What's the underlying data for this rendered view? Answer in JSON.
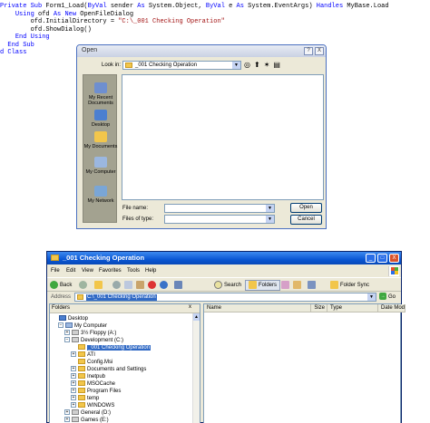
{
  "code": {
    "lines": [
      [
        {
          "t": "Private Sub",
          "k": "kw"
        },
        {
          "t": " Form1_Load("
        },
        {
          "t": "ByVal",
          "k": "kw"
        },
        {
          "t": " sender "
        },
        {
          "t": "As",
          "k": "kw"
        },
        {
          "t": " System.Object, "
        },
        {
          "t": "ByVal",
          "k": "kw"
        },
        {
          "t": " e "
        },
        {
          "t": "As",
          "k": "kw"
        },
        {
          "t": " System.EventArgs) "
        },
        {
          "t": "Handles",
          "k": "kw"
        },
        {
          "t": " MyBase.Load"
        }
      ],
      [
        {
          "t": "    "
        },
        {
          "t": "Using",
          "k": "kw"
        },
        {
          "t": " ofd "
        },
        {
          "t": "As New",
          "k": "kw"
        },
        {
          "t": " OpenFileDialog"
        }
      ],
      [
        {
          "t": "        ofd.InitialDirectory = "
        },
        {
          "t": "\"C:\\_001 Checking Operation\"",
          "k": "str"
        }
      ],
      [
        {
          "t": "        ofd.ShowDialog()"
        }
      ],
      [
        {
          "t": "    "
        },
        {
          "t": "End Using",
          "k": "kw"
        }
      ],
      [
        {
          "t": "  "
        },
        {
          "t": "End Sub",
          "k": "kw"
        }
      ],
      [
        {
          "t": "d Class",
          "k": "kw"
        }
      ]
    ]
  },
  "open_dialog": {
    "title": "Open",
    "help_glyph": "?",
    "close_glyph": "X",
    "look_in_label": "Look in:",
    "look_in_value": "_001 Checking Operation",
    "dropdown_glyph": "▼",
    "nav_icons": [
      "back-icon",
      "up-folder-icon",
      "new-folder-icon",
      "views-icon"
    ],
    "nav_glyphs": [
      "◎",
      "⬆",
      "✶",
      "▤"
    ],
    "places": [
      {
        "name": "recent",
        "label_1": "My Recent",
        "label_2": "Documents",
        "color": "#6e8fd0"
      },
      {
        "name": "desktop",
        "label_1": "Desktop",
        "label_2": "",
        "color": "#4b7fd0"
      },
      {
        "name": "documents",
        "label_1": "My Documents",
        "label_2": "",
        "color": "#f2c64b"
      },
      {
        "name": "computer",
        "label_1": "My Computer",
        "label_2": "",
        "color": "#9bb7e0"
      },
      {
        "name": "network",
        "label_1": "My Network",
        "label_2": "",
        "color": "#7aa6d6"
      }
    ],
    "file_name_label": "File name:",
    "file_name_value": "",
    "files_of_type_label": "Files of type:",
    "files_of_type_value": "",
    "open_button": "Open",
    "cancel_button": "Cancel"
  },
  "explorer": {
    "title": "_001 Checking Operation",
    "min_glyph": "_",
    "max_glyph": "□",
    "close_glyph": "X",
    "menus": [
      "File",
      "Edit",
      "View",
      "Favorites",
      "Tools",
      "Help"
    ],
    "toolbar": {
      "back": "Back",
      "search": "Search",
      "folders": "Folders",
      "folder_sync": "Folder Sync"
    },
    "address_label": "Address",
    "address_value": "C:\\_001 Checking Operation",
    "go_label": "Go",
    "go_glyph": "→",
    "folders_pane_title": "Folders",
    "folders_pane_close": "x",
    "scroll_up_glyph": "▲",
    "tree": [
      {
        "label": "Desktop",
        "indent": 0,
        "icon": "desk",
        "box": ""
      },
      {
        "label": "My Computer",
        "indent": 1,
        "icon": "comp",
        "box": "−"
      },
      {
        "label": "3½ Floppy (A:)",
        "indent": 2,
        "icon": "drive",
        "box": "+"
      },
      {
        "label": "Development (C:)",
        "indent": 2,
        "icon": "drive",
        "box": "−"
      },
      {
        "label": "_001 Checking Operation",
        "indent": 3,
        "icon": "folder",
        "box": "",
        "selected": true
      },
      {
        "label": "ATI",
        "indent": 3,
        "icon": "folder",
        "box": "+"
      },
      {
        "label": "Config.Msi",
        "indent": 3,
        "icon": "folder",
        "box": ""
      },
      {
        "label": "Documents and Settings",
        "indent": 3,
        "icon": "folder",
        "box": "+"
      },
      {
        "label": "Inetpub",
        "indent": 3,
        "icon": "folder",
        "box": "+"
      },
      {
        "label": "MSOCache",
        "indent": 3,
        "icon": "folder",
        "box": "+"
      },
      {
        "label": "Program Files",
        "indent": 3,
        "icon": "folder",
        "box": "+"
      },
      {
        "label": "temp",
        "indent": 3,
        "icon": "folder",
        "box": "+"
      },
      {
        "label": "WINDOWS",
        "indent": 3,
        "icon": "folder",
        "box": "+"
      },
      {
        "label": "General (D:)",
        "indent": 2,
        "icon": "drive",
        "box": "+"
      },
      {
        "label": "Games (E:)",
        "indent": 2,
        "icon": "drive",
        "box": "+"
      }
    ],
    "columns": [
      "Name",
      "Size",
      "Type",
      "Date Mod"
    ]
  }
}
